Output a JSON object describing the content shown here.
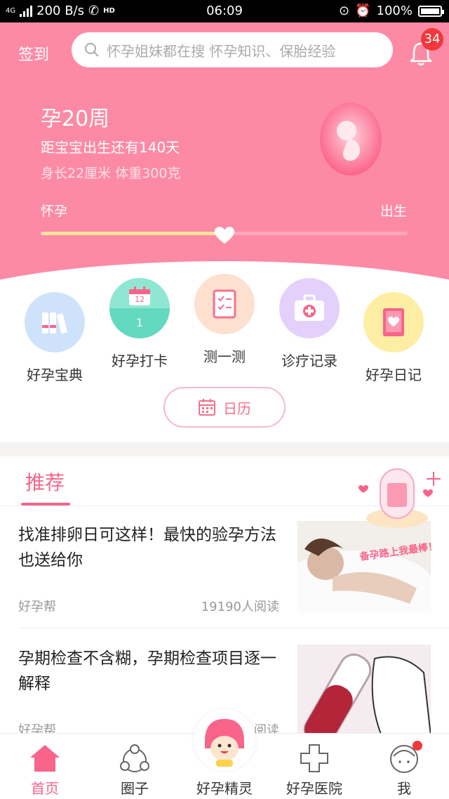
{
  "status_bar": {
    "network": "4G",
    "speed": "200 B/s",
    "hd": "HD",
    "time": "06:09",
    "battery": "100%"
  },
  "header": {
    "signin_label": "签到",
    "search_placeholder": "怀孕姐妹都在搜 怀孕知识、保胎经验",
    "notification_count": "34"
  },
  "pregnancy": {
    "week": "孕20周",
    "countdown": "距宝宝出生还有140天",
    "measure": "身长22厘米   体重300克",
    "start_label": "怀孕",
    "end_label": "出生",
    "progress": 0.5
  },
  "tools": [
    {
      "label": "好孕宝典",
      "icon": "books-icon",
      "color": "#cfe2fb"
    },
    {
      "label": "好孕打卡",
      "icon": "checkin-calendar-icon",
      "color": "#63d9bf",
      "day": "12",
      "count": "1"
    },
    {
      "label": "测一测",
      "icon": "checklist-icon",
      "color": "#fde0cf"
    },
    {
      "label": "诊疗记录",
      "icon": "medical-kit-icon",
      "color": "#e3d1fb"
    },
    {
      "label": "好孕日记",
      "icon": "diary-icon",
      "color": "#fdeea3"
    }
  ],
  "calendar_button": "日历",
  "recommend": {
    "tab_label": "推荐",
    "articles": [
      {
        "title": "找准排卵日可这样！最快的验孕方法也送给你",
        "source": "好孕帮",
        "reads": "19190人阅读"
      },
      {
        "title": "孕期检查不含糊，孕期检查项目逐一解释",
        "source": "好孕帮",
        "reads": "阅读"
      }
    ],
    "floating_banner": "备孕路上我最棒！"
  },
  "tabbar": {
    "items": [
      {
        "label": "首页",
        "icon": "home-icon",
        "active": true
      },
      {
        "label": "圈子",
        "icon": "circle-community-icon",
        "active": false
      },
      {
        "label": "好孕精灵",
        "icon": "genie-mascot-icon",
        "active": false
      },
      {
        "label": "好孕医院",
        "icon": "hospital-cross-icon",
        "active": false
      },
      {
        "label": "我",
        "icon": "profile-icon",
        "active": false
      }
    ]
  },
  "colors": {
    "brand_pink": "#fd8aa5",
    "accent": "#f8648a",
    "badge": "#f2373d"
  }
}
